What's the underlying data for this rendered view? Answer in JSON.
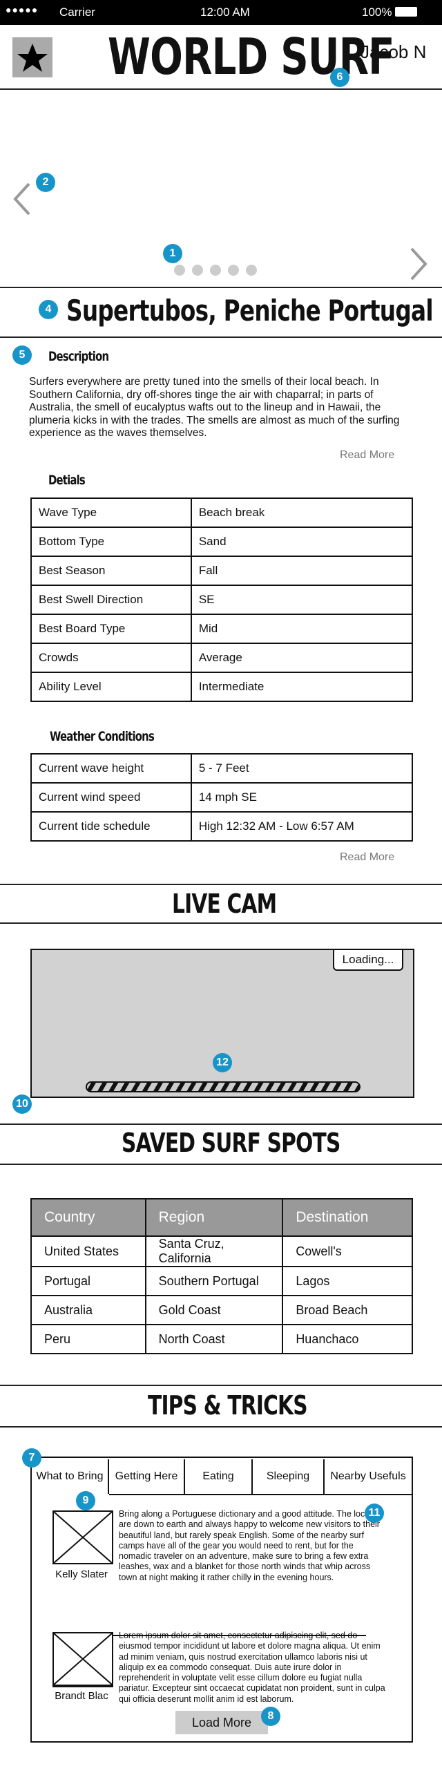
{
  "status_bar": {
    "carrier": "Carrier",
    "time": "12:00 AM",
    "battery": "100%"
  },
  "header": {
    "logo": "WORLD SURF",
    "user": "Jacob N"
  },
  "spot": {
    "title": "Supertubos, Peniche Portugal"
  },
  "description": {
    "heading": "Description",
    "text": "Surfers everywhere are pretty tuned into the smells of their local beach. In Southern California, dry off-shores tinge the air with chaparral; in parts of Australia, the smell of eucalyptus wafts out to the lineup and in Hawaii, the plumeria kicks in with the trades. The smells are almost as much of the surfing experience as the waves themselves.",
    "read_more": "Read More"
  },
  "details": {
    "heading": "Detials",
    "rows": [
      [
        "Wave Type",
        "Beach break"
      ],
      [
        "Bottom Type",
        "Sand"
      ],
      [
        "Best Season",
        "Fall"
      ],
      [
        "Best Swell Direction",
        "SE"
      ],
      [
        "Best Board Type",
        "Mid"
      ],
      [
        "Crowds",
        "Average"
      ],
      [
        "Ability Level",
        "Intermediate"
      ]
    ]
  },
  "weather": {
    "heading": "Weather Conditions",
    "rows": [
      [
        "Current wave height",
        "5 - 7 Feet"
      ],
      [
        "Current wind speed",
        "14 mph SE"
      ],
      [
        "Current tide schedule",
        "High 12:32 AM  -  Low 6:57 AM"
      ]
    ],
    "read_more": "Read More"
  },
  "livecam": {
    "heading": "LIVE CAM",
    "loading": "Loading..."
  },
  "saved": {
    "heading": "SAVED SURF SPOTS",
    "columns": [
      "Country",
      "Region",
      "Destination"
    ],
    "rows": [
      [
        "United States",
        "Santa Cruz, California",
        "Cowell's"
      ],
      [
        "Portugal",
        "Southern Portugal",
        "Lagos"
      ],
      [
        "Australia",
        "Gold Coast",
        "Broad Beach"
      ],
      [
        "Peru",
        "North Coast",
        "Huanchaco"
      ]
    ]
  },
  "tips": {
    "heading": "TIPS & TRICKS",
    "tabs": [
      "What to Bring",
      "Getting Here",
      "Eating",
      "Sleeping",
      "Nearby Usefuls"
    ],
    "posts": [
      {
        "author": "Kelly Slater",
        "text": "Bring along a Portuguese dictionary and a good attitude. The locals are down to earth and always happy to welcome new visitors to their beautiful land, but rarely speak English. Some of the nearby surf camps have all of the gear you would need to rent, but for the nomadic traveler on an adventure, make sure to bring a few extra leashes, wax and a blanket for those north winds that whip across town at night making it rather chilly in the evening hours."
      },
      {
        "author": "Brandt Blac",
        "text": "Lorem ipsum dolor sit amet, consectetur adipiscing elit, sed do eiusmod tempor incididunt ut labore et dolore magna aliqua. Ut enim ad minim veniam, quis nostrud exercitation ullamco laboris nisi ut aliquip ex ea commodo consequat. Duis aute irure dolor in reprehenderit in voluptate velit esse cillum dolore eu fugiat nulla pariatur. Excepteur sint occaecat cupidatat non proident, sunt in culpa qui officia deserunt mollit anim id est laborum."
      }
    ],
    "load_more": "Load More"
  },
  "annotations": [
    "1",
    "2",
    "4",
    "5",
    "6",
    "7",
    "8",
    "9",
    "10",
    "11",
    "12"
  ]
}
